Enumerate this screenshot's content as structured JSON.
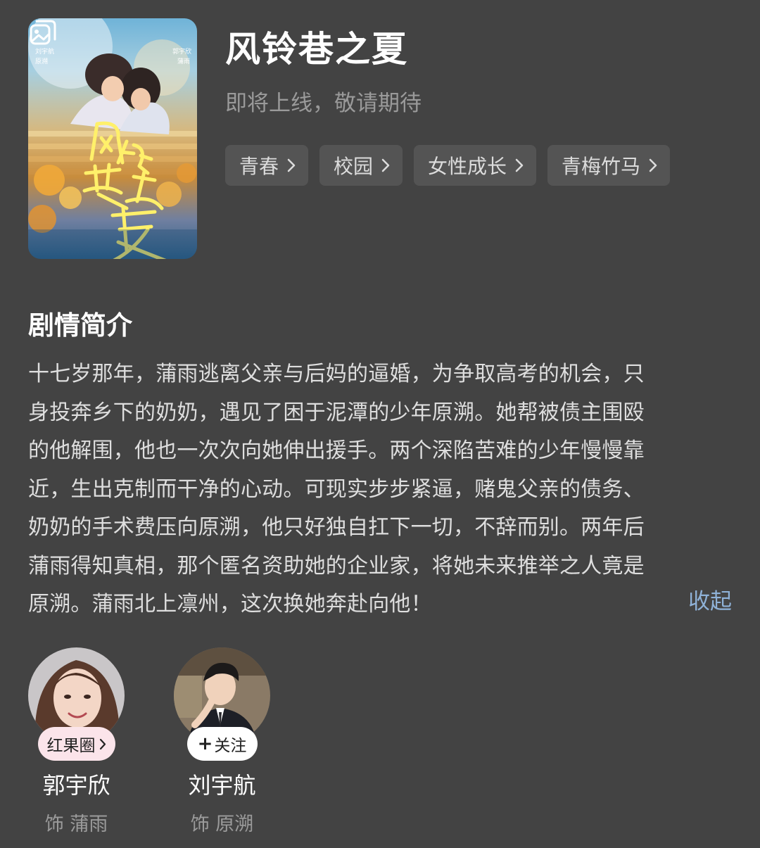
{
  "drama": {
    "title": "风铃巷之夏",
    "status": "即将上线，敬请期待",
    "tags": [
      "青春",
      "校园",
      "女性成长",
      "青梅竹马"
    ]
  },
  "poster": {
    "title_art": "风铃巷之夏",
    "cast_credits": [
      "刘宇航",
      "原溯",
      "郭宇欣",
      "蒲雨"
    ]
  },
  "synopsis": {
    "heading": "剧情简介",
    "lines": [
      "十七岁那年，蒲雨逃离父亲与后妈的逼婚，为争取高考的机会，只",
      "身投奔乡下的奶奶，遇见了困于泥潭的少年原溯。她帮被债主围殴",
      "的他解围，他也一次次向她伸出援手。两个深陷苦难的少年慢慢靠",
      "近，生出克制而干净的心动。可现实步步紧逼，赌鬼父亲的债务、",
      "奶奶的手术费压向原溯，他只好独自扛下一切，不辞而别。两年后",
      "蒲雨得知真相，那个匿名资助她的企业家，将她未来推举之人竟是",
      "原溯。蒲雨北上凛州，这次换她奔赴向他！"
    ],
    "collapse_label": "收起"
  },
  "cast": [
    {
      "name": "郭宇欣",
      "role": "饰 蒲雨",
      "action_label": "红果圈"
    },
    {
      "name": "刘宇航",
      "role": "饰 原溯",
      "action_label": "关注"
    }
  ],
  "icons": {
    "gallery": "gallery-icon",
    "chevron": "chevron-right-icon",
    "plus": "plus-icon"
  },
  "colors": {
    "background": "#434343",
    "tag_bg": "#545454",
    "link": "#8fb2d8",
    "pill_pink": "#fbe4ea"
  }
}
